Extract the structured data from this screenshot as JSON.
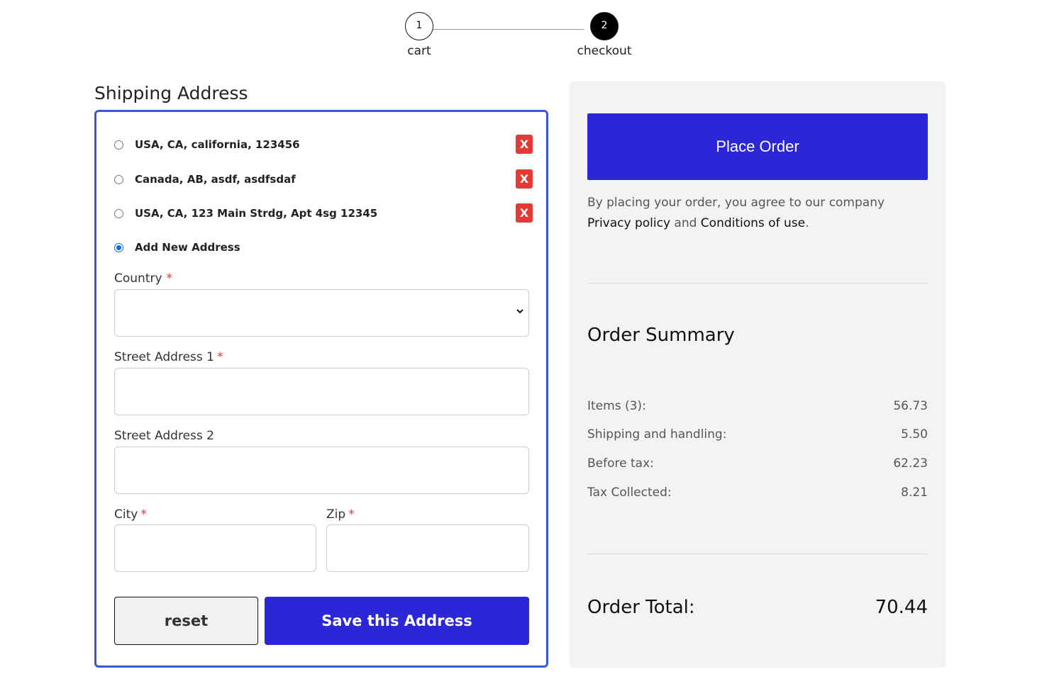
{
  "stepper": {
    "steps": [
      {
        "number": "1",
        "label": "cart",
        "active": false
      },
      {
        "number": "2",
        "label": "checkout",
        "active": true
      }
    ]
  },
  "shipping": {
    "title": "Shipping Address",
    "addresses": [
      {
        "text": "USA, CA, california, 123456",
        "selected": false,
        "delete_label": "X"
      },
      {
        "text": "Canada, AB, asdf, asdfsdaf",
        "selected": false,
        "delete_label": "X"
      },
      {
        "text": "USA, CA, 123 Main Strdg, Apt 4sg 12345",
        "selected": false,
        "delete_label": "X"
      }
    ],
    "add_new": {
      "text": "Add New Address",
      "selected": true
    },
    "form": {
      "country_label": "Country",
      "country_value": "",
      "street1_label": "Street Address 1",
      "street1_value": "",
      "street2_label": "Street Address 2",
      "street2_value": "",
      "city_label": "City",
      "city_value": "",
      "zip_label": "Zip",
      "zip_value": "",
      "required_mark": "*"
    },
    "reset_label": "reset",
    "save_label": "Save this Address"
  },
  "summary": {
    "place_order_label": "Place Order",
    "agree_text": "By placing your order, you agree to our company",
    "privacy_link": "Privacy policy",
    "and_text": "and",
    "conditions_link": "Conditions of use",
    "period": ".",
    "title": "Order Summary",
    "rows": [
      {
        "label": "Items (3):",
        "value": "56.73"
      },
      {
        "label": "Shipping and handling:",
        "value": "5.50"
      },
      {
        "label": "Before tax:",
        "value": "62.23"
      },
      {
        "label": "Tax Collected:",
        "value": "8.21"
      }
    ],
    "total_label": "Order Total:",
    "total_value": "70.44"
  },
  "colors": {
    "primary": "#2c27d6",
    "border_accent": "#3a57d6",
    "danger": "#e53935",
    "panel_bg": "#f3f3f3"
  }
}
